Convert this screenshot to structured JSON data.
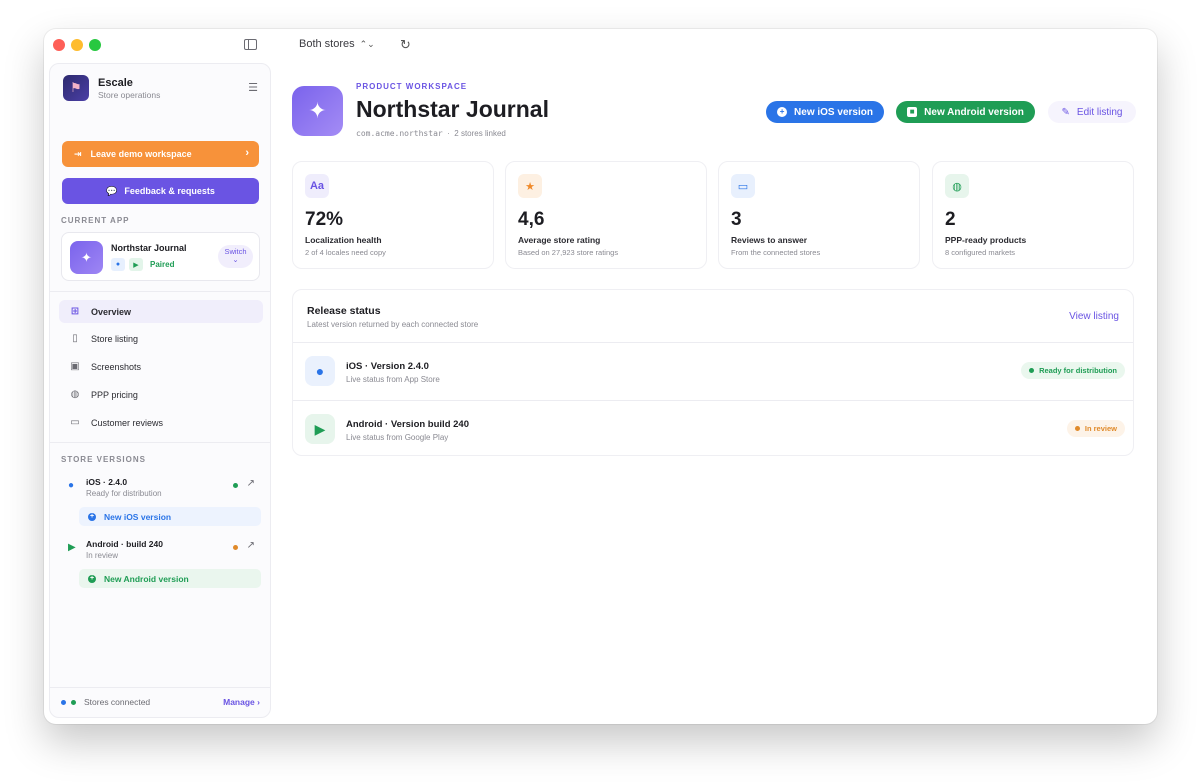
{
  "toolbar": {
    "store_select": "Both stores"
  },
  "brand": {
    "name": "Escale",
    "subtitle": "Store operations"
  },
  "sidebar": {
    "demo_button": "Leave demo workspace",
    "feedback_button": "Feedback & requests",
    "current_app_label": "CURRENT APP",
    "current_app": {
      "name": "Northstar Journal",
      "status": "Paired",
      "switch_label": "Switch"
    },
    "nav": [
      {
        "label": "Overview",
        "icon": "grid-icon",
        "active": true
      },
      {
        "label": "Store listing",
        "icon": "document-icon"
      },
      {
        "label": "Screenshots",
        "icon": "images-icon"
      },
      {
        "label": "PPP pricing",
        "icon": "globe-icon"
      },
      {
        "label": "Customer reviews",
        "icon": "chat-icon"
      }
    ],
    "store_versions_label": "STORE VERSIONS",
    "versions": [
      {
        "title": "iOS · 2.4.0",
        "status": "Ready for distribution",
        "button": "New iOS version",
        "dot_color": "#1f9d55"
      },
      {
        "title": "Android · build 240",
        "status": "In review",
        "button": "New Android version",
        "dot_color": "#e08a2a"
      }
    ],
    "footer": {
      "label": "Stores connected",
      "manage": "Manage",
      "dot_colors": [
        "#2a74e7",
        "#1f9d55"
      ]
    }
  },
  "header": {
    "eyebrow": "PRODUCT WORKSPACE",
    "title": "Northstar Journal",
    "bundle": "com.acme.northstar",
    "separator": "·",
    "stores": "2 stores linked",
    "buttons": {
      "ios": "New iOS version",
      "android": "New Android version",
      "edit": "Edit listing"
    }
  },
  "stats": [
    {
      "icon": "Aa",
      "icon_name": "typography-icon",
      "value": "72%",
      "label": "Localization health",
      "sub": "2 of 4 locales need copy",
      "color": "#6a54e3",
      "bg": "#efedfc"
    },
    {
      "icon": "★",
      "icon_name": "star-icon",
      "value": "4,6",
      "label": "Average store rating",
      "sub": "Based on 27,923 store ratings",
      "color": "#f08a2a",
      "bg": "#fdf0e2"
    },
    {
      "icon": "▭",
      "icon_name": "chat-icon",
      "value": "3",
      "label": "Reviews to answer",
      "sub": "From the connected stores",
      "color": "#2a74e7",
      "bg": "#e8f0fd"
    },
    {
      "icon": "◍",
      "icon_name": "globe-icon",
      "value": "2",
      "label": "PPP-ready products",
      "sub": "8 configured markets",
      "color": "#1f9d55",
      "bg": "#e7f5ec"
    }
  ],
  "release": {
    "title": "Release status",
    "subtitle": "Latest version returned by each connected store",
    "link": "View listing",
    "rows": [
      {
        "name": "iOS · Version 2.4.0",
        "desc": "Live status from App Store",
        "status": "Ready for distribution"
      },
      {
        "name": "Android · Version build 240",
        "desc": "Live status from Google Play",
        "status": "In review"
      }
    ]
  }
}
